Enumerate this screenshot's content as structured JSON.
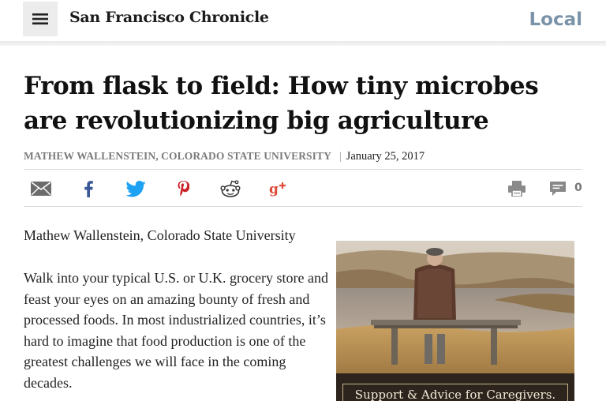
{
  "header": {
    "menu_icon": "hamburger-menu-icon",
    "masthead": "San Francisco Chronicle",
    "section": "Local"
  },
  "article": {
    "headline": "From flask to field: How tiny microbes are revolutionizing big agriculture",
    "author": "MATHEW WALLENSTEIN, COLORADO STATE UNIVERSITY",
    "separator": "|",
    "date": "January 25, 2017",
    "credit": "Mathew Wallenstein, Colorado State University",
    "paragraph": "Walk into your typical U.S. or U.K. grocery store and feast your eyes on an amazing bounty of fresh and processed foods. In most industrialized countries, it’s hard to imagine that food production is one of the greatest challenges we will face in the coming decades."
  },
  "share": {
    "icons": [
      "email-icon",
      "facebook-icon",
      "twitter-icon",
      "pinterest-icon",
      "reddit-icon",
      "google-plus-icon",
      "print-icon",
      "comment-icon"
    ],
    "comment_count": "0",
    "colors": {
      "email": "#666666",
      "facebook": "#3b5998",
      "twitter": "#1da1f2",
      "pinterest": "#cb2027",
      "reddit": "#333333",
      "googleplus": "#dd4b39",
      "tools": "#888888"
    }
  },
  "ad": {
    "text": "Support & Advice for Caregivers."
  },
  "colors": {
    "section": "#7a93a8",
    "author": "#7b7b7b",
    "menu_bg": "#ececec"
  }
}
